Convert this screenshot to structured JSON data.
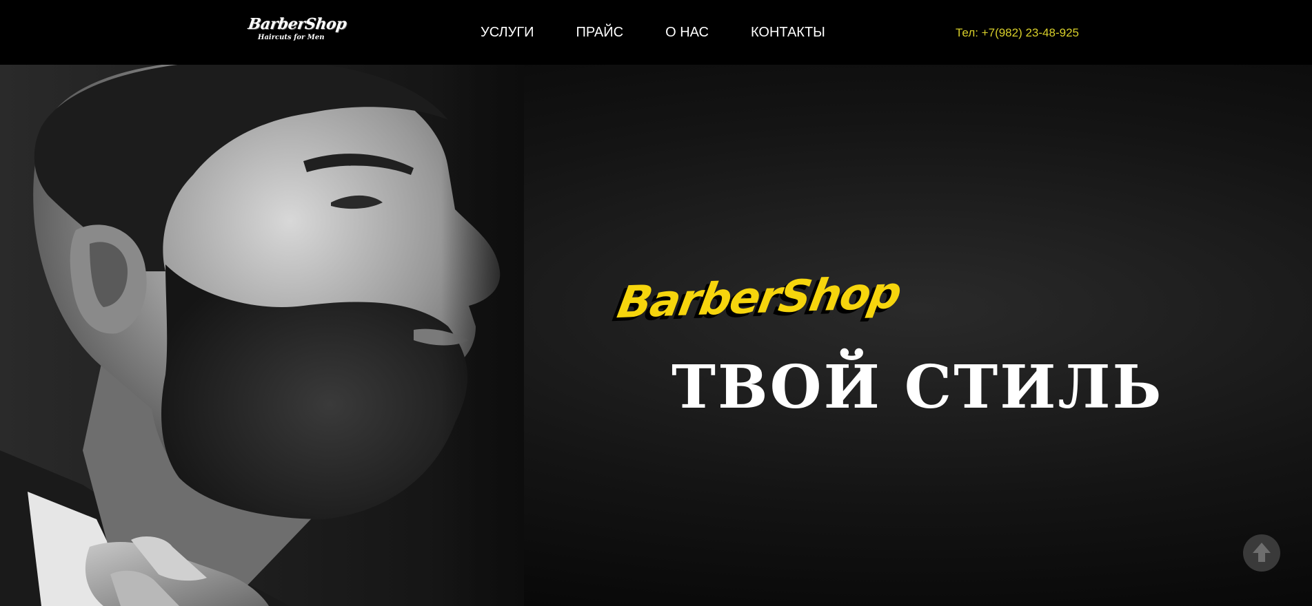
{
  "header": {
    "logo_main": "BarberShop",
    "logo_sub": "Haircuts for Men",
    "nav": [
      {
        "label": "УСЛУГИ"
      },
      {
        "label": "ПРАЙС"
      },
      {
        "label": "О НАС"
      },
      {
        "label": "КОНТАКТЫ"
      }
    ],
    "phone": "Тел: +7(982) 23-48-925"
  },
  "hero": {
    "brand": "BarberShop",
    "title": "ТВОЙ СТИЛЬ",
    "image": "bearded-man-profile-photo"
  },
  "icons": {
    "scroll_top": "arrow-up-icon"
  },
  "colors": {
    "accent": "#f6d50d",
    "phone": "#d8cf2a",
    "header_bg": "#000000"
  }
}
